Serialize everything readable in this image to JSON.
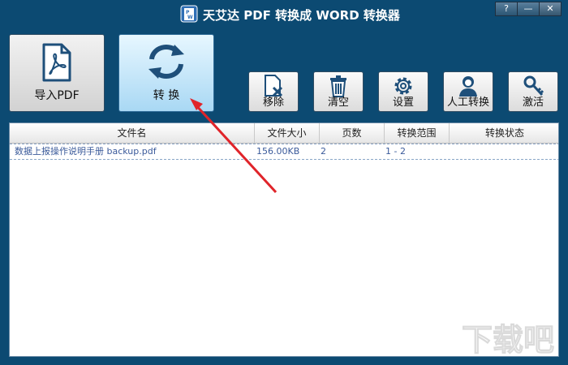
{
  "window": {
    "title": "天艾达 PDF 转换成 WORD 转换器",
    "help_label": "?",
    "min_label": "—",
    "close_label": "✕"
  },
  "toolbar": {
    "import_label": "导入PDF",
    "convert_label": "转 换",
    "remove_label": "移除",
    "clear_label": "清空",
    "settings_label": "设置",
    "manual_label": "人工转换",
    "activate_label": "激活"
  },
  "table": {
    "headers": [
      "文件名",
      "文件大小",
      "页数",
      "转换范围",
      "转换状态"
    ],
    "rows": [
      {
        "name": "数据上报操作说明手册 backup.pdf",
        "size": "156.00KB",
        "pages": "2",
        "range": "1 - 2",
        "status": ""
      }
    ]
  },
  "icons": {
    "app": "pdf-word-app-icon",
    "import": "pdf-file-icon",
    "convert": "refresh-arrows-icon",
    "remove": "file-remove-icon",
    "clear": "trash-icon",
    "settings": "gear-icon",
    "manual": "person-icon",
    "activate": "key-icon"
  },
  "colors": {
    "window_bg": "#0c4a72",
    "convert_btn_bg": "#a9d8f4",
    "arrow": "#e0242a",
    "row_text": "#3a5a9a"
  },
  "watermark": "下载吧"
}
